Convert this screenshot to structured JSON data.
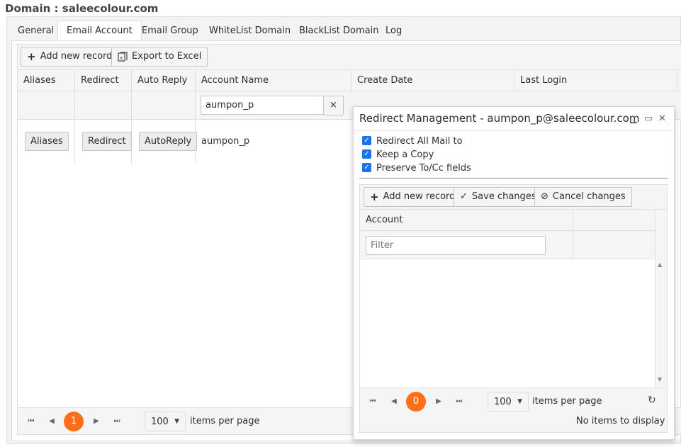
{
  "page": {
    "title": "Domain : saleecolour.com"
  },
  "tabs": [
    {
      "label": "General"
    },
    {
      "label": "Email Account"
    },
    {
      "label": "Email Group"
    },
    {
      "label": "WhiteList Domain"
    },
    {
      "label": "BlackList Domain"
    },
    {
      "label": "Log"
    }
  ],
  "toolbar": {
    "add_label": "Add new record",
    "export_label": "Export to Excel"
  },
  "grid": {
    "columns": [
      "Aliases List",
      "Redirect",
      "Auto Reply",
      "Account Name",
      "Create Date",
      "Last Login"
    ],
    "filter": {
      "account_name_value": "aumpon_p",
      "clear_glyph": "×"
    },
    "rows": [
      {
        "aliases_btn": "Aliases",
        "redirect_btn": "Redirect",
        "autoreply_btn": "AutoReply",
        "account_name": "aumpon_p"
      }
    ],
    "pager": {
      "current_page": "1",
      "page_size": "100",
      "items_per_page_label": "items per page"
    }
  },
  "modal": {
    "title": "Redirect Management - aumpon_p@saleecolour.com",
    "options": [
      {
        "label": "Redirect All Mail to",
        "checked": true
      },
      {
        "label": "Keep a Copy",
        "checked": true
      },
      {
        "label": "Preserve To/Cc fields",
        "checked": true
      }
    ],
    "toolbar": {
      "add_label": "Add new record",
      "save_label": "Save changes",
      "cancel_label": "Cancel changes"
    },
    "grid": {
      "column": "Account",
      "filter_placeholder": "Filter",
      "pager": {
        "current_page": "0",
        "page_size": "100",
        "items_per_page_label": "items per page",
        "empty_text": "No items to display"
      }
    }
  },
  "colors": {
    "accent": "#ff6e1a",
    "checkbox": "#1a73e8"
  }
}
